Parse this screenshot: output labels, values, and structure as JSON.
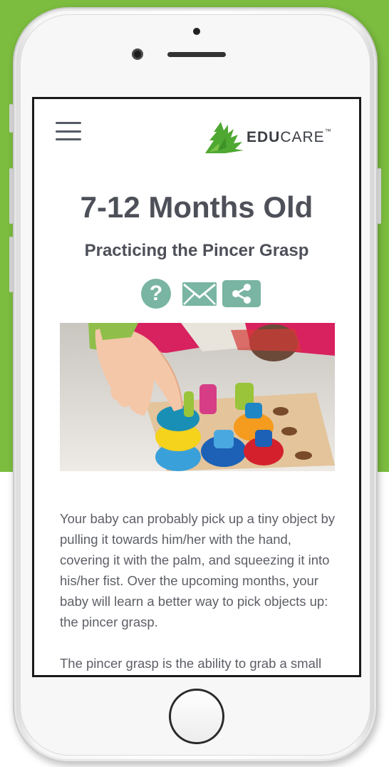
{
  "header": {
    "menu_icon": "hamburger-menu-icon",
    "logo": {
      "bold": "EDU",
      "regular": "CARE",
      "tm": "™",
      "icon": "green-leaf-logo"
    }
  },
  "article": {
    "title": "7-12 Months Old",
    "subtitle": "Practicing the Pincer Grasp",
    "actions": {
      "help_icon": "question-mark-icon",
      "help_glyph": "?",
      "mail_icon": "envelope-icon",
      "share_icon": "share-icon"
    },
    "hero_image": "baby hand stacking colorful wooden ring toys",
    "paragraphs": [
      "Your baby can probably pick up a tiny object by pulling it towards him/her with the hand, covering it with the palm, and squeezing it into his/her fist. Over the upcoming months, your baby will learn a better way to pick objects up: the pincer grasp.",
      "The pincer grasp is the ability to grab a small"
    ]
  },
  "colors": {
    "background_green": "#7cbd3f",
    "accent_teal": "#79b5a2",
    "heading": "#4e5059",
    "body": "#5d5f66",
    "logo_green": "#4fa832"
  }
}
